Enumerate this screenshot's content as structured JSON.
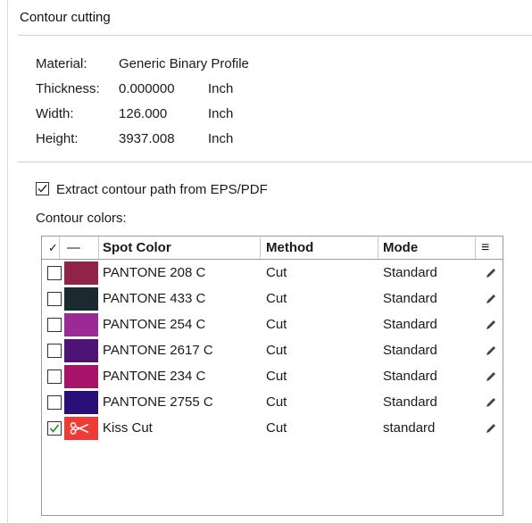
{
  "section": {
    "title": "Contour cutting"
  },
  "properties": [
    {
      "label": "Material:",
      "value": "Generic Binary Profile",
      "unit": ""
    },
    {
      "label": "Thickness:",
      "value": "0.000000",
      "unit": "Inch"
    },
    {
      "label": "Width:",
      "value": "126.000",
      "unit": "Inch"
    },
    {
      "label": "Height:",
      "value": "3937.008",
      "unit": "Inch"
    }
  ],
  "extract": {
    "label": "Extract contour path from EPS/PDF",
    "checked": true
  },
  "contour_colors_label": "Contour colors:",
  "table": {
    "headers": {
      "check": "✓",
      "color": "—",
      "spot": "Spot Color",
      "method": "Method",
      "mode": "Mode",
      "menu": "≡"
    },
    "rows": [
      {
        "checked": false,
        "swatch": "#8f2448",
        "spot": "PANTONE 208 C",
        "method": "Cut",
        "mode": "Standard",
        "icon": "pencil-icon"
      },
      {
        "checked": false,
        "swatch": "#1b2a31",
        "spot": "PANTONE 433 C",
        "method": "Cut",
        "mode": "Standard",
        "icon": "pencil-icon"
      },
      {
        "checked": false,
        "swatch": "#9b2a97",
        "spot": "PANTONE 254 C",
        "method": "Cut",
        "mode": "Standard",
        "icon": "pencil-icon"
      },
      {
        "checked": false,
        "swatch": "#4d1475",
        "spot": "PANTONE 2617 C",
        "method": "Cut",
        "mode": "Standard",
        "icon": "pencil-icon"
      },
      {
        "checked": false,
        "swatch": "#a81268",
        "spot": "PANTONE 234 C",
        "method": "Cut",
        "mode": "Standard",
        "icon": "pencil-icon"
      },
      {
        "checked": false,
        "swatch": "#2b0f79",
        "spot": "PANTONE 2755 C",
        "method": "Cut",
        "mode": "Standard",
        "icon": "pencil-icon"
      },
      {
        "checked": true,
        "swatch": "#ef3b36",
        "swatch_icon": "scissors-icon",
        "spot": "Kiss Cut",
        "method": "Cut",
        "mode": "standard",
        "icon": "pencil-icon"
      }
    ]
  }
}
